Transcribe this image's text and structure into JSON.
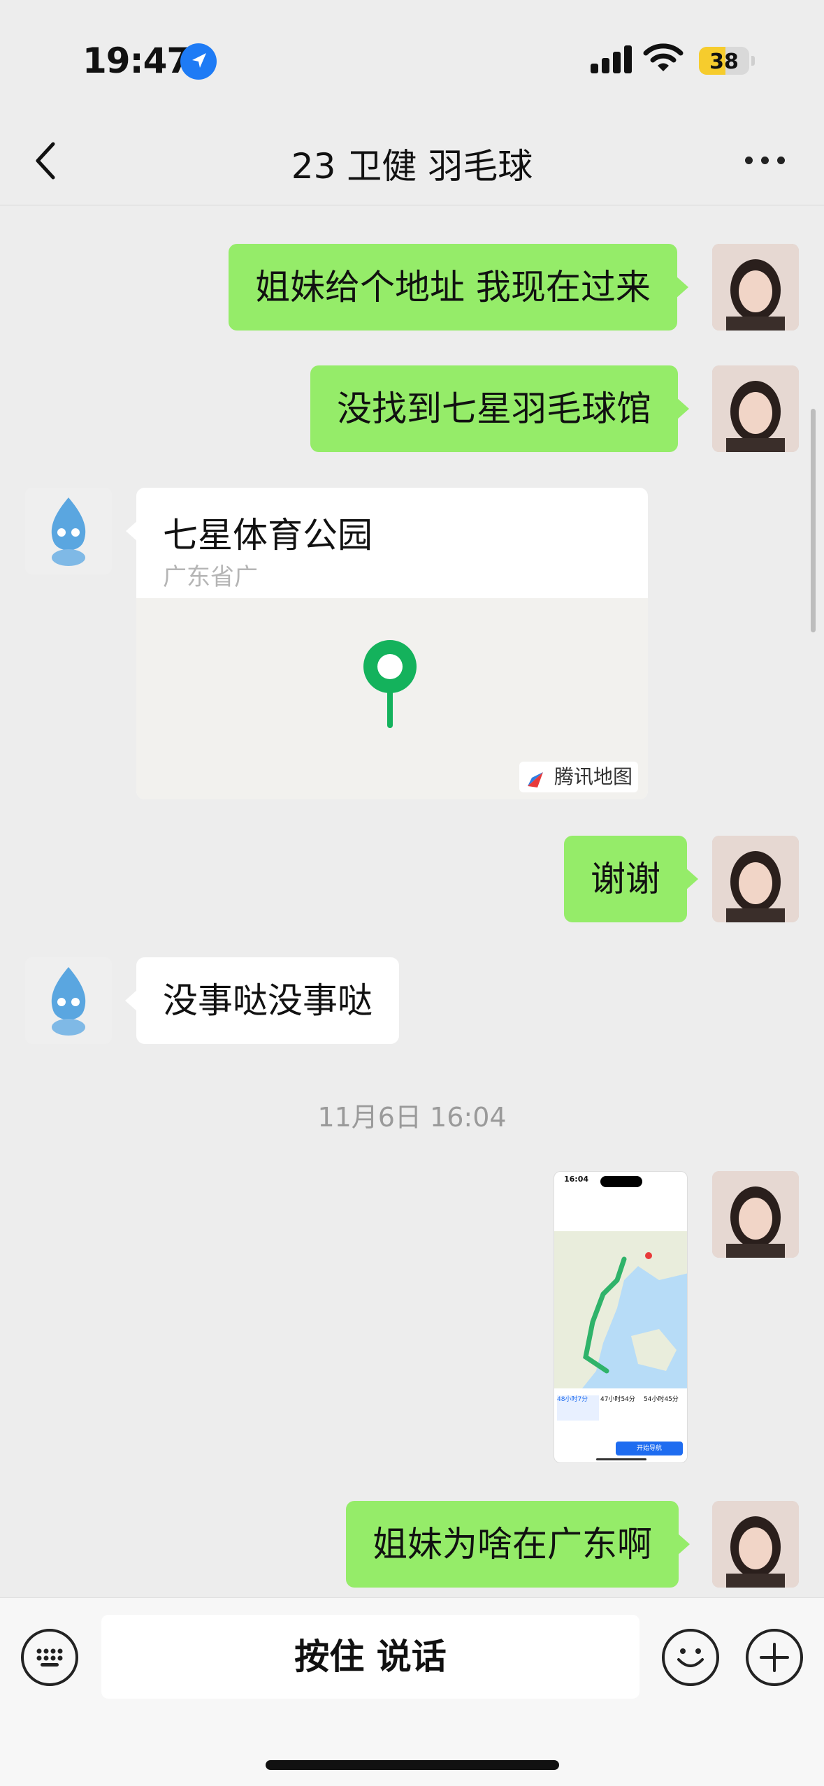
{
  "status_bar": {
    "time": "19:47",
    "battery": "38"
  },
  "header": {
    "title": "23 卫健 羽毛球"
  },
  "messages": [
    {
      "side": "me",
      "text": "姐妹给个地址 我现在过来"
    },
    {
      "side": "me",
      "text": "没找到七星羽毛球馆"
    },
    {
      "side": "other",
      "type": "location",
      "name": "七星体育公园",
      "address": "广东省广",
      "map_provider": "腾讯地图"
    },
    {
      "side": "me",
      "text": "谢谢"
    },
    {
      "side": "other",
      "text": "没事哒没事哒"
    },
    {
      "side": "me",
      "type": "image"
    },
    {
      "side": "me",
      "text": "姐妹为啥在广东啊"
    }
  ],
  "timestamp": "11月6日 16:04",
  "screenshot": {
    "time": "16:04",
    "options": [
      "48小时7分",
      "47小时54分",
      "54小时45分"
    ],
    "start_nav": "开始导航"
  },
  "input_bar": {
    "voice_label": "按住 说话"
  },
  "colors": {
    "my_bubble": "#95ec69",
    "other_bubble": "#ffffff",
    "background": "#ededed",
    "location_pin": "#14b25c"
  }
}
